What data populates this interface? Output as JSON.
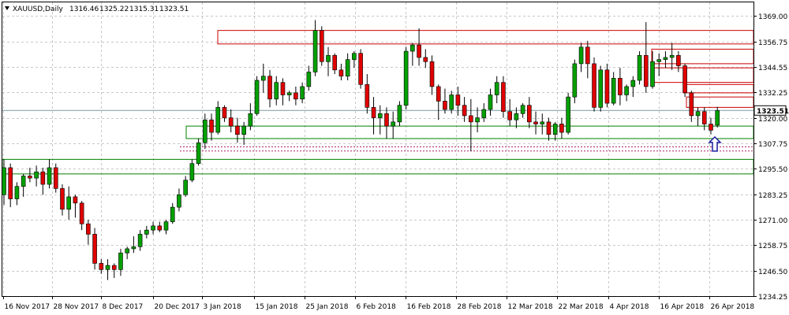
{
  "chart_data": {
    "type": "candlestick",
    "symbol": "XAUUSD,Daily",
    "ohlc_header": {
      "open": "1316.46",
      "high": "1325.22",
      "low": "1315.31",
      "close": "1323.51"
    },
    "current_price_label": "1323.51",
    "current_price": 1323.51,
    "ylim": [
      1234.25,
      1375.5
    ],
    "grid": true,
    "y_ticks": [
      "1369.00",
      "1356.75",
      "1344.55",
      "1332.25",
      "1320.00",
      "1307.75",
      "1295.50",
      "1283.25",
      "1271.00",
      "1258.75",
      "1246.50",
      "1234.25"
    ],
    "x_ticks": [
      "16 Nov 2017",
      "28 Nov 2017",
      "8 Dec 2017",
      "20 Dec 2017",
      "3 Jan 2018",
      "15 Jan 2018",
      "25 Jan 2018",
      "6 Feb 2018",
      "16 Feb 2018",
      "28 Feb 2018",
      "12 Mar 2018",
      "22 Mar 2018",
      "4 Apr 2018",
      "16 Apr 2018",
      "26 Apr 2018"
    ],
    "candles": [
      [
        1283,
        1300,
        1278,
        1296
      ],
      [
        1296,
        1298,
        1277,
        1281
      ],
      [
        1281,
        1289,
        1278,
        1287
      ],
      [
        1287,
        1293,
        1282,
        1292
      ],
      [
        1292,
        1296,
        1289,
        1291
      ],
      [
        1291,
        1297,
        1287,
        1294
      ],
      [
        1294,
        1296,
        1283,
        1288
      ],
      [
        1288,
        1300,
        1286,
        1296
      ],
      [
        1296,
        1298,
        1284,
        1286
      ],
      [
        1286,
        1288,
        1273,
        1276
      ],
      [
        1276,
        1287,
        1271,
        1282
      ],
      [
        1282,
        1283,
        1272,
        1279
      ],
      [
        1279,
        1280,
        1266,
        1269
      ],
      [
        1269,
        1271,
        1259,
        1264
      ],
      [
        1264,
        1267,
        1247,
        1250
      ],
      [
        1250,
        1252,
        1245,
        1247
      ],
      [
        1247,
        1252,
        1242,
        1249
      ],
      [
        1249,
        1250,
        1243,
        1247
      ],
      [
        1247,
        1257,
        1244,
        1255
      ],
      [
        1255,
        1258,
        1252,
        1257
      ],
      [
        1257,
        1263,
        1255,
        1258
      ],
      [
        1258,
        1266,
        1256,
        1264
      ],
      [
        1264,
        1268,
        1262,
        1266
      ],
      [
        1266,
        1270,
        1264,
        1268
      ],
      [
        1268,
        1270,
        1265,
        1266
      ],
      [
        1266,
        1271,
        1264,
        1270
      ],
      [
        1270,
        1279,
        1269,
        1277
      ],
      [
        1277,
        1286,
        1275,
        1283
      ],
      [
        1283,
        1292,
        1282,
        1290
      ],
      [
        1290,
        1300,
        1289,
        1298
      ],
      [
        1298,
        1310,
        1297,
        1308
      ],
      [
        1308,
        1322,
        1305,
        1319
      ],
      [
        1319,
        1322,
        1309,
        1313
      ],
      [
        1313,
        1328,
        1312,
        1325
      ],
      [
        1325,
        1326,
        1318,
        1320
      ],
      [
        1320,
        1324,
        1313,
        1316
      ],
      [
        1316,
        1320,
        1308,
        1312
      ],
      [
        1312,
        1318,
        1307,
        1316
      ],
      [
        1316,
        1327,
        1314,
        1322
      ],
      [
        1322,
        1340,
        1321,
        1338
      ],
      [
        1338,
        1346,
        1332,
        1340
      ],
      [
        1340,
        1343,
        1325,
        1329
      ],
      [
        1329,
        1340,
        1326,
        1337
      ],
      [
        1337,
        1339,
        1326,
        1331
      ],
      [
        1331,
        1333,
        1328,
        1332
      ],
      [
        1332,
        1335,
        1326,
        1329
      ],
      [
        1329,
        1337,
        1327,
        1335
      ],
      [
        1335,
        1345,
        1333,
        1342
      ],
      [
        1342,
        1367,
        1340,
        1362
      ],
      [
        1362,
        1364,
        1345,
        1347
      ],
      [
        1347,
        1354,
        1340,
        1350
      ],
      [
        1350,
        1351,
        1341,
        1343
      ],
      [
        1343,
        1346,
        1338,
        1340
      ],
      [
        1340,
        1351,
        1338,
        1348
      ],
      [
        1348,
        1352,
        1344,
        1351
      ],
      [
        1351,
        1353,
        1334,
        1336
      ],
      [
        1336,
        1341,
        1322,
        1325
      ],
      [
        1325,
        1330,
        1312,
        1320
      ],
      [
        1320,
        1326,
        1312,
        1322
      ],
      [
        1322,
        1325,
        1310,
        1316
      ],
      [
        1316,
        1323,
        1310,
        1318
      ],
      [
        1318,
        1328,
        1316,
        1326
      ],
      [
        1326,
        1354,
        1324,
        1352
      ],
      [
        1352,
        1356,
        1345,
        1355
      ],
      [
        1355,
        1363,
        1345,
        1349
      ],
      [
        1349,
        1353,
        1344,
        1347
      ],
      [
        1347,
        1350,
        1331,
        1335
      ],
      [
        1335,
        1336,
        1319,
        1328
      ],
      [
        1328,
        1334,
        1322,
        1324
      ],
      [
        1324,
        1333,
        1322,
        1331
      ],
      [
        1331,
        1335,
        1321,
        1326
      ],
      [
        1326,
        1330,
        1318,
        1321
      ],
      [
        1321,
        1329,
        1304,
        1318
      ],
      [
        1318,
        1325,
        1313,
        1320
      ],
      [
        1320,
        1327,
        1318,
        1324
      ],
      [
        1324,
        1334,
        1321,
        1331
      ],
      [
        1331,
        1340,
        1327,
        1337
      ],
      [
        1337,
        1340,
        1320,
        1323
      ],
      [
        1323,
        1329,
        1316,
        1319
      ],
      [
        1319,
        1325,
        1315,
        1322
      ],
      [
        1322,
        1327,
        1320,
        1326
      ],
      [
        1326,
        1330,
        1315,
        1318
      ],
      [
        1318,
        1323,
        1312,
        1317
      ],
      [
        1317,
        1322,
        1312,
        1318
      ],
      [
        1318,
        1320,
        1309,
        1312
      ],
      [
        1312,
        1318,
        1309,
        1317
      ],
      [
        1317,
        1320,
        1310,
        1313
      ],
      [
        1313,
        1332,
        1312,
        1330
      ],
      [
        1330,
        1348,
        1327,
        1346
      ],
      [
        1346,
        1356,
        1342,
        1354
      ],
      [
        1354,
        1357,
        1339,
        1346
      ],
      [
        1346,
        1349,
        1323,
        1325
      ],
      [
        1325,
        1345,
        1323,
        1343
      ],
      [
        1343,
        1346,
        1325,
        1327
      ],
      [
        1327,
        1342,
        1326,
        1339
      ],
      [
        1339,
        1344,
        1326,
        1331
      ],
      [
        1331,
        1336,
        1328,
        1335
      ],
      [
        1335,
        1340,
        1330,
        1338
      ],
      [
        1338,
        1352,
        1336,
        1350
      ],
      [
        1350,
        1366,
        1332,
        1335
      ],
      [
        1335,
        1352,
        1334,
        1347
      ],
      [
        1347,
        1351,
        1340,
        1348
      ],
      [
        1348,
        1352,
        1344,
        1349
      ],
      [
        1349,
        1356,
        1343,
        1350
      ],
      [
        1350,
        1352,
        1342,
        1345
      ],
      [
        1345,
        1346,
        1330,
        1332
      ],
      [
        1332,
        1333,
        1318,
        1321
      ],
      [
        1321,
        1325,
        1316,
        1323
      ],
      [
        1323,
        1325,
        1314,
        1317
      ],
      [
        1317,
        1320,
        1312,
        1314
      ],
      [
        1316.46,
        1325.22,
        1315.31,
        1323.51
      ]
    ],
    "support_zones": [
      {
        "from": 1310,
        "to": 1316
      },
      {
        "from": 1300,
        "to": 1293
      }
    ],
    "resistance_zones": [
      {
        "from": 1355.5,
        "to": 1362
      },
      {
        "from": 1346,
        "to": 1353
      },
      {
        "from": 1337,
        "to": 1344
      },
      {
        "from": 1332,
        "to": 1336
      },
      {
        "from": 1325,
        "to": 1330
      }
    ],
    "price_lines": [
      1323.51
    ],
    "dashed_levels": [
      1306,
      1304
    ],
    "arrow_marker": {
      "direction": "up",
      "price": 1307
    }
  }
}
